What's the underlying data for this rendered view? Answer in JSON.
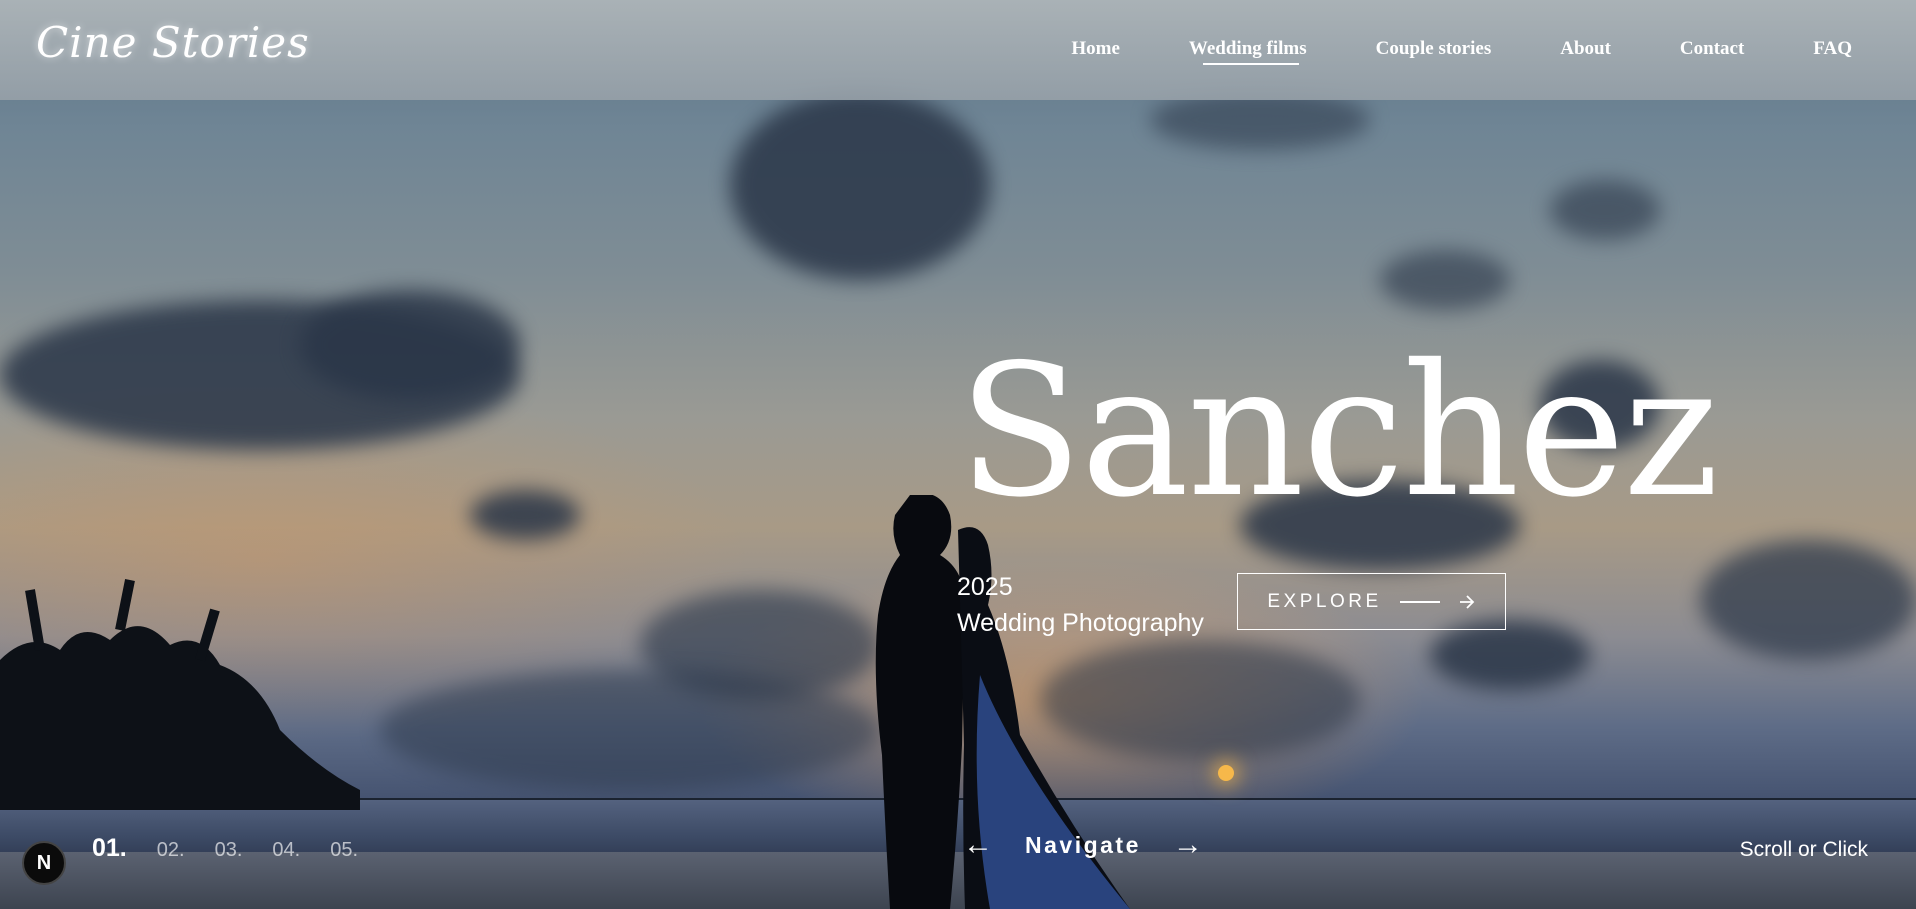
{
  "header": {
    "logo": "Cine Stories",
    "nav": [
      {
        "label": "Home",
        "active": false
      },
      {
        "label": "Wedding films",
        "active": true
      },
      {
        "label": "Couple stories",
        "active": false
      },
      {
        "label": "About",
        "active": false
      },
      {
        "label": "Contact",
        "active": false
      },
      {
        "label": "FAQ",
        "active": false
      }
    ]
  },
  "hero": {
    "title": "Sanchez",
    "year": "2025",
    "subtitle": "Wedding Photography",
    "explore_label": "EXPLORE"
  },
  "footer": {
    "badge": "N",
    "pages": [
      "01.",
      "02.",
      "03.",
      "04.",
      "05."
    ],
    "current_page": 0,
    "prev_arrow": "←",
    "navigate_label": "Navigate",
    "next_arrow": "→",
    "scroll_hint": "Scroll or Click"
  },
  "icons": {
    "explore_arrow": "arrow-right-icon",
    "prev": "arrow-left-icon",
    "next": "arrow-right-icon"
  },
  "colors": {
    "sun": "#f6b84a",
    "header_overlay": "#a9b0b4"
  }
}
